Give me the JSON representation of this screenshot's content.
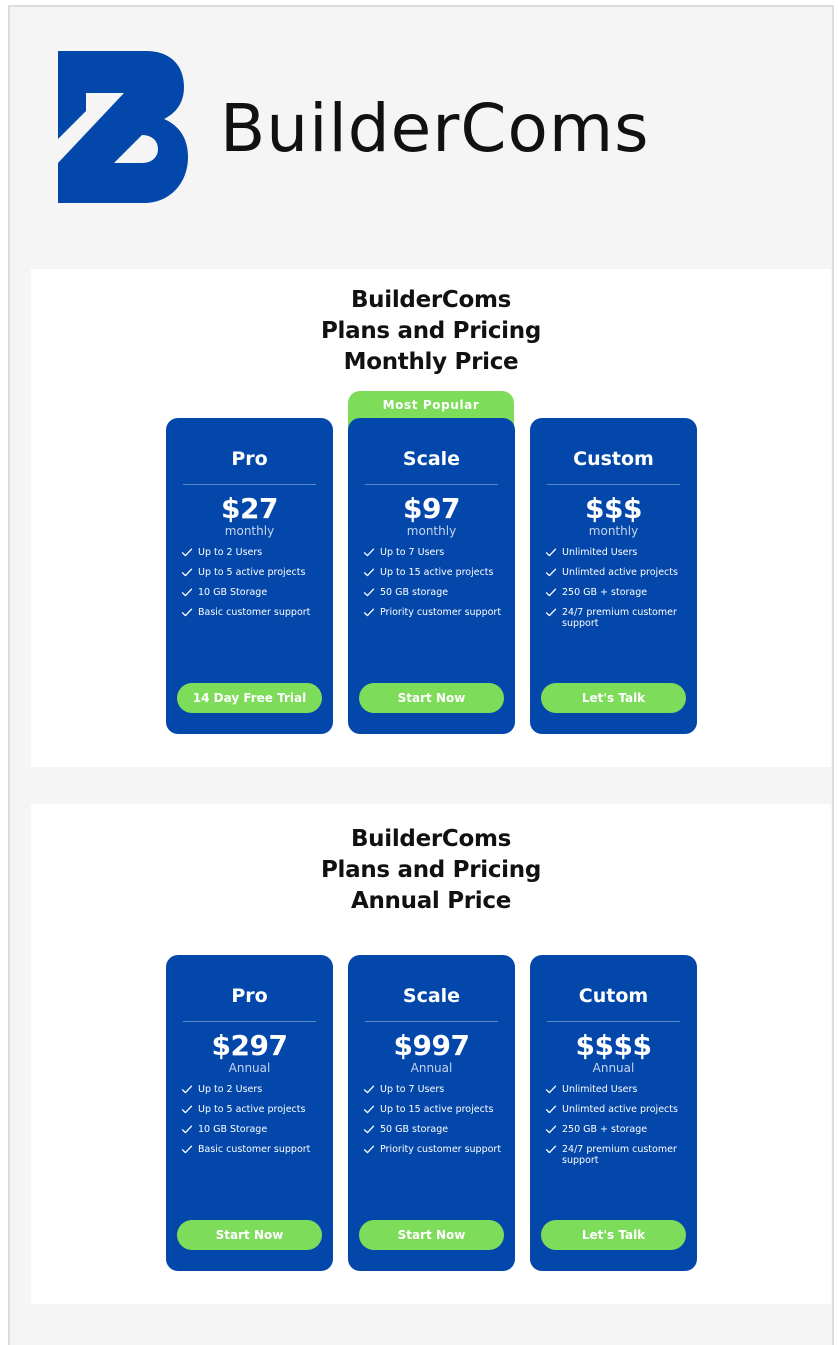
{
  "brand": {
    "name": "BuilderComs",
    "logo_icon": "builder-b-logo",
    "logo_color": "#0447ab"
  },
  "colors": {
    "card_bg": "#0447ab",
    "accent_green": "#7edc5b",
    "section_bg": "#ffffff",
    "page_bg": "#f5f5f5"
  },
  "monthly": {
    "title_line1": "BuilderComs",
    "title_line2": "Plans and Pricing",
    "title_line3": "Monthly Price",
    "badge": "Most Popular",
    "plans": [
      {
        "name": "Pro",
        "price": "$27",
        "period": "monthly",
        "features": [
          "Up to 2 Users",
          "Up to 5 active projects",
          "10 GB Storage",
          "Basic customer support"
        ],
        "cta": "14 Day Free Trial"
      },
      {
        "name": "Scale",
        "price": "$97",
        "period": "monthly",
        "features": [
          "Up to 7 Users",
          "Up to 15 active projects",
          "50 GB storage",
          "Priority customer support"
        ],
        "cta": "Start Now"
      },
      {
        "name": "Custom",
        "price": "$$$",
        "period": "monthly",
        "features": [
          "Unlimited Users",
          "Unlimted active projects",
          "250 GB + storage",
          "24/7 premium customer support"
        ],
        "cta": "Let's Talk"
      }
    ]
  },
  "annual": {
    "title_line1": "BuilderComs",
    "title_line2": "Plans and Pricing",
    "title_line3": "Annual Price",
    "plans": [
      {
        "name": "Pro",
        "price": "$297",
        "period": "Annual",
        "features": [
          "Up to 2 Users",
          "Up to 5 active projects",
          "10 GB Storage",
          "Basic customer support"
        ],
        "cta": "Start Now"
      },
      {
        "name": "Scale",
        "price": "$997",
        "period": "Annual",
        "features": [
          "Up to 7 Users",
          "Up to 15 active projects",
          "50 GB storage",
          "Priority customer support"
        ],
        "cta": "Start Now"
      },
      {
        "name": "Cutom",
        "price": "$$$$",
        "period": "Annual",
        "features": [
          "Unlimited Users",
          "Unlimted active projects",
          "250 GB + storage",
          "24/7 premium customer support"
        ],
        "cta": "Let's Talk"
      }
    ]
  },
  "icons": {
    "feature_bullet": "check-icon"
  }
}
